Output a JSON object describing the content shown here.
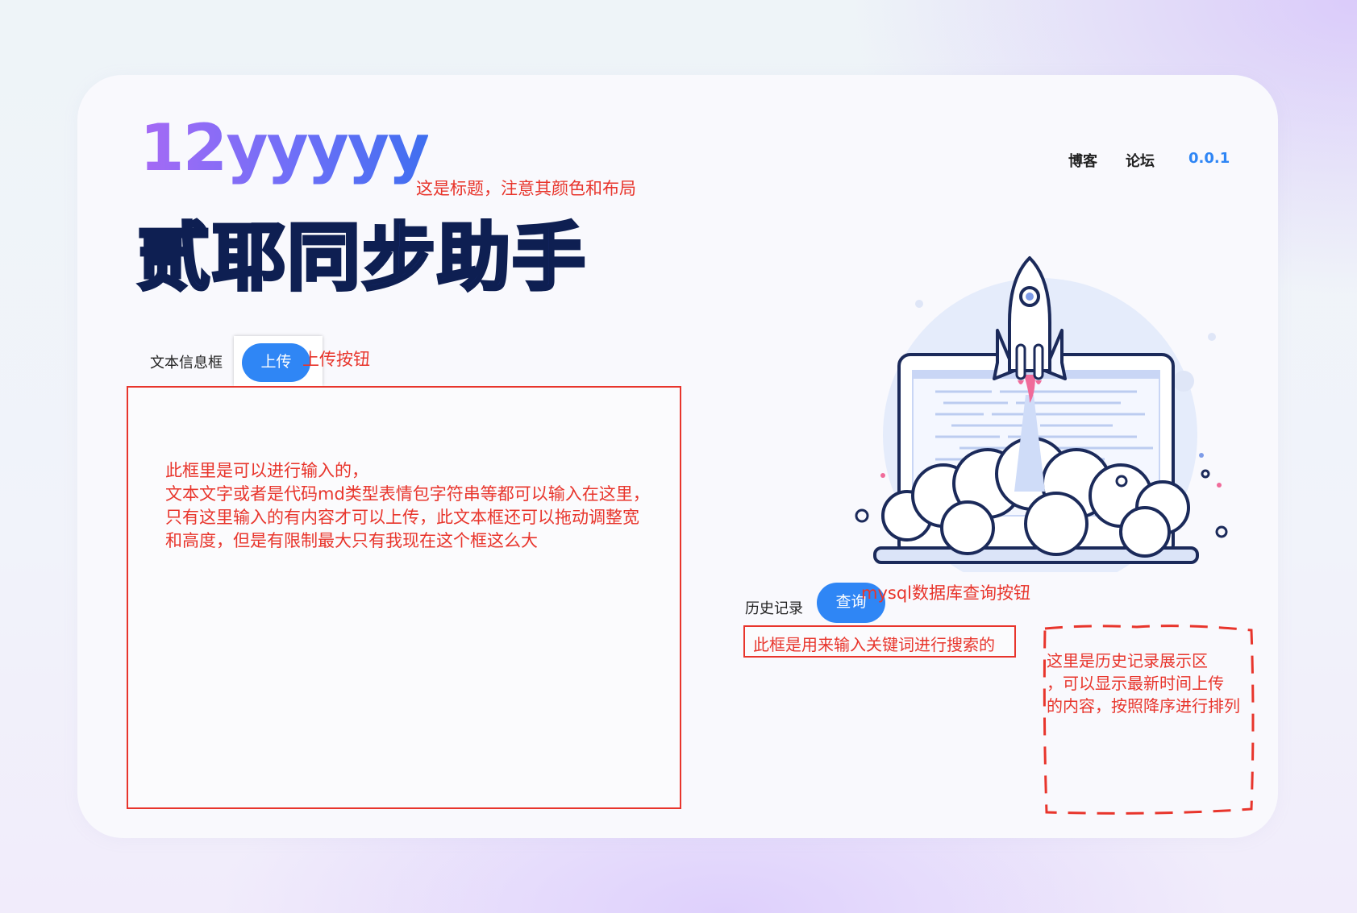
{
  "header": {
    "logo": "12yyyyy",
    "logo_note": "这是标题，注意其颜色和布局",
    "nav": {
      "blog": "博客",
      "forum": "论坛",
      "version": "0.0.1"
    }
  },
  "main_title": "贰耶同步助手",
  "upload_section": {
    "label": "文本信息框",
    "upload_button": "上传",
    "upload_note": "上传按钮",
    "textbox_note_lines": [
      "此框里是可以进行输入的，",
      "文本文字或者是代码md类型表情包字符串等都可以输入在这里，",
      "只有这里输入的有内容才可以上传，此文本框还可以拖动调整宽",
      "和高度，但是有限制最大只有我现在这个框这么大"
    ]
  },
  "history_section": {
    "label": "历史记录",
    "query_button": "查询",
    "query_note": "mysql数据库查询按钮",
    "search_note": "此框是用来输入关键词进行搜索的",
    "display_note_lines": [
      "这里是历史记录展示区",
      "，可以显示最新时间上传",
      "的内容，按照降序进行排列"
    ]
  },
  "illustration": "rocket-launch-illustration",
  "colors": {
    "accent_blue": "#2f86f5",
    "annotation_red": "#e8352c",
    "title_navy": "#1a3480",
    "logo_gradient_start": "#a66af5",
    "logo_gradient_end": "#3f6ff0"
  }
}
